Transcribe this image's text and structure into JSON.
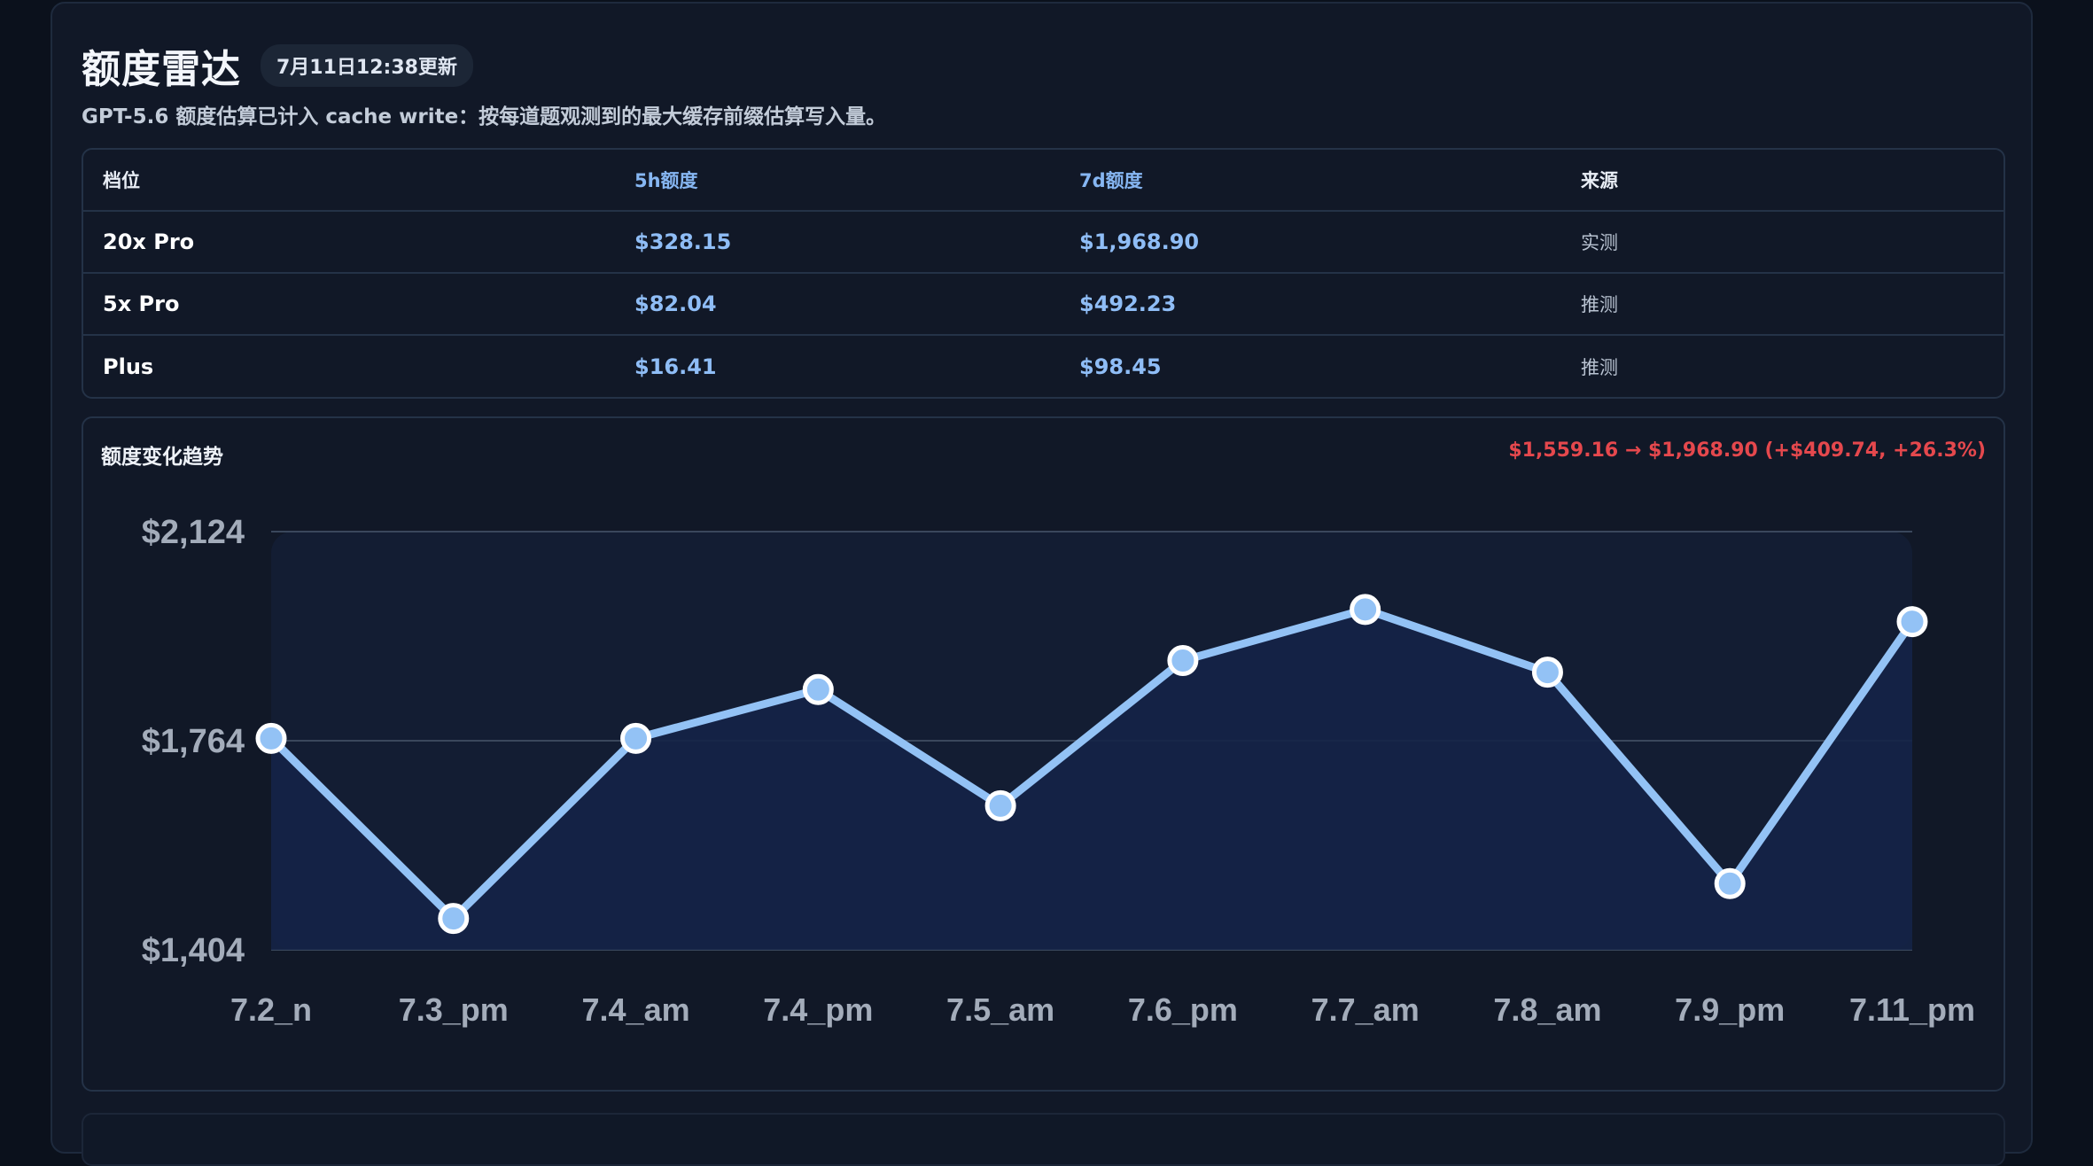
{
  "header": {
    "title": "额度雷达",
    "updated_badge": "7月11日12:38更新",
    "subtitle": "GPT-5.6 额度估算已计入 cache write：按每道题观测到的最大缓存前缀估算写入量。"
  },
  "quota_table": {
    "columns": [
      "档位",
      "5h额度",
      "7d额度",
      "来源"
    ],
    "rows": [
      {
        "tier": "20x Pro",
        "h5": "$328.15",
        "d7": "$1,968.90",
        "source": "实测"
      },
      {
        "tier": "5x Pro",
        "h5": "$82.04",
        "d7": "$492.23",
        "source": "推测"
      },
      {
        "tier": "Plus",
        "h5": "$16.41",
        "d7": "$98.45",
        "source": "推测"
      }
    ]
  },
  "trend": {
    "title": "额度变化趋势",
    "change_text": "$1,559.16 → $1,968.90 (+$409.74, +26.3%)",
    "colors": {
      "line": "#93c2f5",
      "fill": "#152347",
      "change": "#e5484d"
    }
  },
  "chart_data": {
    "type": "line",
    "title": "额度变化趋势",
    "xlabel": "",
    "ylabel": "",
    "categories": [
      "7.2_n",
      "7.3_pm",
      "7.4_am",
      "7.4_pm",
      "7.5_am",
      "7.6_pm",
      "7.7_am",
      "7.8_am",
      "7.9_pm",
      "7.11_pm"
    ],
    "series": [
      {
        "values": [
          1768,
          1458,
          1768,
          1852,
          1652,
          1902,
          1990,
          1882,
          1518,
          1968.9
        ]
      }
    ],
    "yticks": [
      "$2,124",
      "$1,764",
      "$1,404"
    ],
    "ylim": [
      1404,
      2124
    ],
    "grid": true
  }
}
